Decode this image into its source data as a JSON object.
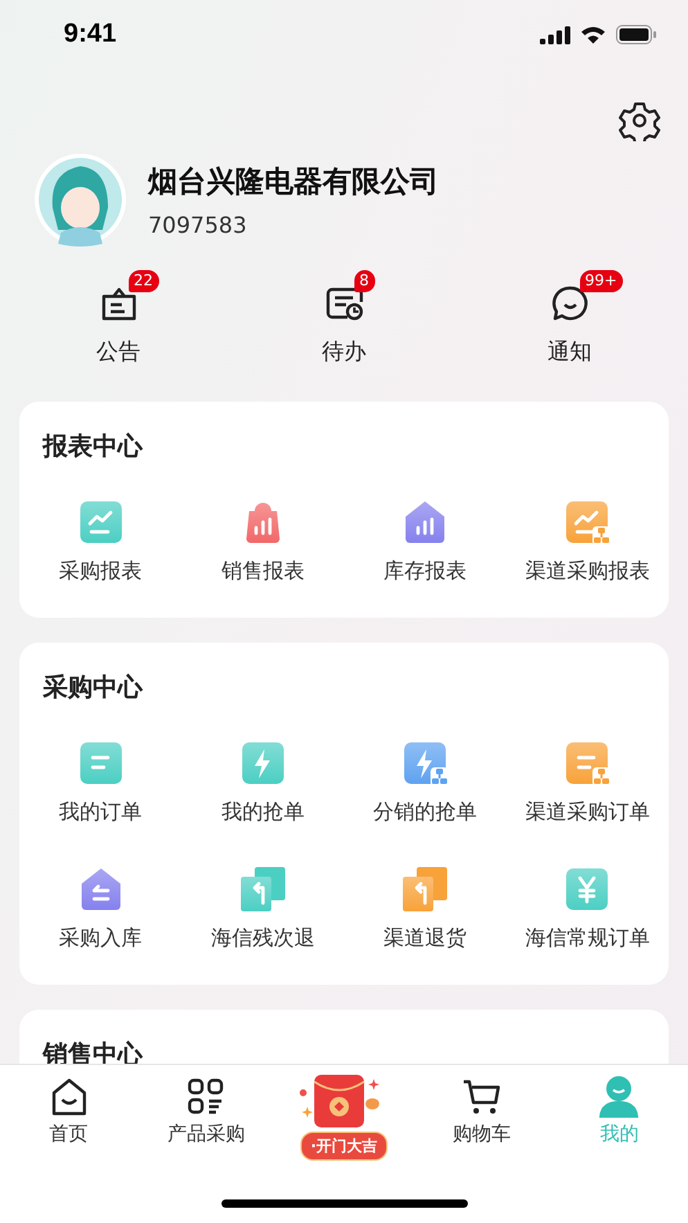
{
  "status_bar": {
    "time": "9:41"
  },
  "profile": {
    "company": "烟台兴隆电器有限公司",
    "id": "7097583"
  },
  "quick_links": [
    {
      "label": "公告",
      "badge": "22",
      "kind": "notice"
    },
    {
      "label": "待办",
      "badge": "8",
      "kind": "todo"
    },
    {
      "label": "通知",
      "badge": "99+",
      "kind": "chat"
    }
  ],
  "sections": [
    {
      "title": "报表中心",
      "items": [
        {
          "label": "采购报表",
          "kind": "chart",
          "color": "#4ccfc3"
        },
        {
          "label": "销售报表",
          "kind": "bag",
          "color": "#f26868"
        },
        {
          "label": "库存报表",
          "kind": "house-bars",
          "color": "#8581ee"
        },
        {
          "label": "渠道采购报表",
          "kind": "chart-network",
          "color": "#f8a23a"
        }
      ]
    },
    {
      "title": "采购中心",
      "items": [
        {
          "label": "我的订单",
          "kind": "doc",
          "color": "#4ccfc3"
        },
        {
          "label": "我的抢单",
          "kind": "bolt",
          "color": "#4ccfc3"
        },
        {
          "label": "分销的抢单",
          "kind": "bolt-network",
          "color": "#5fa2f0"
        },
        {
          "label": "渠道采购订单",
          "kind": "doc-network",
          "color": "#f8a23a"
        },
        {
          "label": "采购入库",
          "kind": "house-in",
          "color": "#8581ee"
        },
        {
          "label": "海信残次退",
          "kind": "return",
          "color": "#4ccfc3"
        },
        {
          "label": "渠道退货",
          "kind": "return",
          "color": "#f8a23a"
        },
        {
          "label": "海信常规订单",
          "kind": "yen",
          "color": "#4ccfc3"
        }
      ]
    },
    {
      "title": "销售中心"
    }
  ],
  "tab_bar": [
    {
      "label": "首页",
      "kind": "home",
      "selected": false
    },
    {
      "label": "产品采购",
      "kind": "grid",
      "selected": false
    },
    {
      "label": "·开门大吉",
      "kind": "promo",
      "selected": false
    },
    {
      "label": "购物车",
      "kind": "cart",
      "selected": false
    },
    {
      "label": "我的",
      "kind": "person",
      "selected": true
    }
  ]
}
